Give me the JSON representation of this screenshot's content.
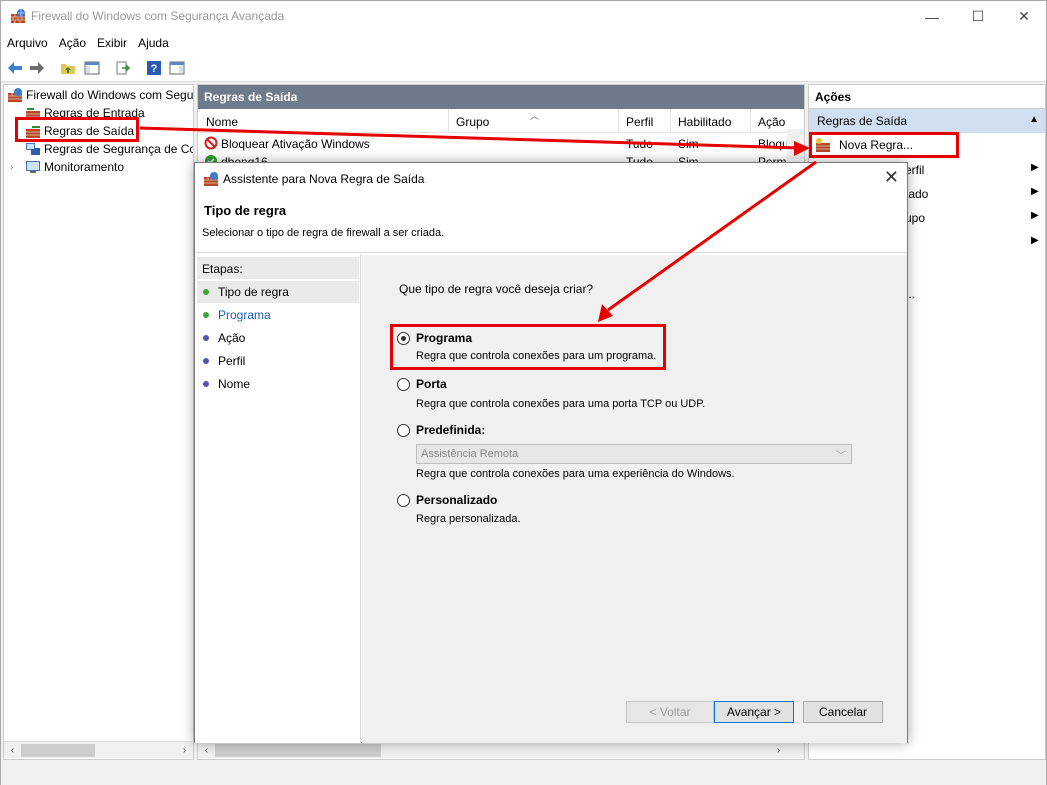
{
  "window": {
    "title": "Firewall do Windows com Segurança Avançada"
  },
  "menu": [
    "Arquivo",
    "Ação",
    "Exibir",
    "Ajuda"
  ],
  "tree": {
    "root": "Firewall do Windows com Segur",
    "items": [
      {
        "label": "Regras de Entrada"
      },
      {
        "label": "Regras de Saída"
      },
      {
        "label": "Regras de Segurança de Cor"
      },
      {
        "label": "Monitoramento"
      }
    ]
  },
  "center": {
    "header": "Regras de Saída",
    "columns": [
      "Nome",
      "Grupo",
      "Perfil",
      "Habilitado",
      "Ação"
    ],
    "rows": [
      {
        "name": "Bloquear Ativação Windows",
        "profile": "Tudo",
        "enabled": "Sim",
        "action": "Bloqu..."
      },
      {
        "name": "dbeng16",
        "profile": "Tudo",
        "enabled": "Sim",
        "action": "Perm..."
      }
    ]
  },
  "actions": {
    "header": "Ações",
    "section": "Regras de Saída",
    "new_rule": "Nova Regra...",
    "partial": [
      "erfil",
      "tado",
      "upo",
      "..."
    ]
  },
  "dialog": {
    "title": "Assistente para Nova Regra de Saída",
    "heading": "Tipo de regra",
    "subheading": "Selecionar o tipo de regra de firewall a ser criada.",
    "steps_header": "Etapas:",
    "steps": [
      {
        "label": "Tipo de regra",
        "color": "#3aa63a"
      },
      {
        "label": "Programa",
        "color": "#3aa63a"
      },
      {
        "label": "Ação",
        "color": "#5555b0"
      },
      {
        "label": "Perfil",
        "color": "#5555b0"
      },
      {
        "label": "Nome",
        "color": "#5555b0"
      }
    ],
    "question": "Que tipo de regra você deseja criar?",
    "options": [
      {
        "label": "Programa",
        "desc": "Regra que controla conexões para um programa.",
        "selected": true
      },
      {
        "label": "Porta",
        "desc": "Regra que controla conexões para uma porta TCP ou UDP.",
        "selected": false
      },
      {
        "label": "Predefinida:",
        "desc": "Regra que controla conexões para uma experiência do Windows.",
        "selected": false
      },
      {
        "label": "Personalizado",
        "desc": "Regra personalizada.",
        "selected": false
      }
    ],
    "predefined_value": "Assistência Remota",
    "buttons": {
      "back": "< Voltar",
      "next": "Avançar >",
      "cancel": "Cancelar"
    }
  },
  "colors": {
    "highlight": "#e60000",
    "pane_header": "#6e7b8b",
    "selection": "#cfdfef",
    "accent": "#0078d7"
  }
}
